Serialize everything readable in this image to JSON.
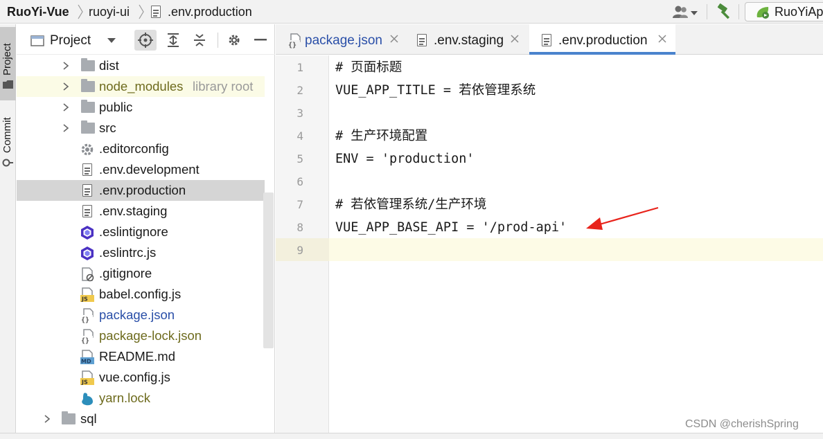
{
  "breadcrumb": {
    "project": "RuoYi-Vue",
    "folder": "ruoyi-ui",
    "file": ".env.production"
  },
  "toolbar": {
    "run_config_label": "RuoYiAp",
    "user_icon": "user-icon",
    "build_icon": "hammer-icon",
    "accent_green": "#4b8b3b"
  },
  "tool_window_tabs": {
    "project": "Project",
    "commit": "Commit"
  },
  "project_panel": {
    "title": "Project",
    "items": [
      {
        "label": "dist",
        "type": "folder",
        "expandable": true
      },
      {
        "label": "node_modules",
        "note": "library root",
        "type": "folder",
        "expandable": true
      },
      {
        "label": "public",
        "type": "folder",
        "expandable": true
      },
      {
        "label": "src",
        "type": "folder",
        "expandable": true
      },
      {
        "label": ".editorconfig",
        "type": "gear-file"
      },
      {
        "label": ".env.development",
        "type": "text-file"
      },
      {
        "label": ".env.production",
        "type": "text-file",
        "selected": true
      },
      {
        "label": ".env.staging",
        "type": "text-file"
      },
      {
        "label": ".eslintignore",
        "type": "eslint-file"
      },
      {
        "label": ".eslintrc.js",
        "type": "eslint-file"
      },
      {
        "label": ".gitignore",
        "type": "ignore-file"
      },
      {
        "label": "babel.config.js",
        "type": "js-file"
      },
      {
        "label": "package.json",
        "type": "json-file",
        "color": "blue"
      },
      {
        "label": "package-lock.json",
        "type": "json-file",
        "color": "olive"
      },
      {
        "label": "README.md",
        "type": "md-file"
      },
      {
        "label": "vue.config.js",
        "type": "js-file"
      },
      {
        "label": "yarn.lock",
        "type": "yarn-file",
        "color": "olive"
      },
      {
        "label": "sql",
        "type": "folder",
        "expandable": true,
        "level": 0
      }
    ]
  },
  "editor_tabs": [
    {
      "label": "package.json",
      "icon": "json-file-icon",
      "color": "blue"
    },
    {
      "label": ".env.staging",
      "icon": "text-file-icon"
    },
    {
      "label": ".env.production",
      "icon": "text-file-icon",
      "active": true
    }
  ],
  "editor": {
    "lines": [
      {
        "n": "1",
        "text": "# 页面标题"
      },
      {
        "n": "2",
        "text": "VUE_APP_TITLE = 若依管理系统"
      },
      {
        "n": "3",
        "text": ""
      },
      {
        "n": "4",
        "text": "# 生产环境配置"
      },
      {
        "n": "5",
        "text": "ENV = 'production'"
      },
      {
        "n": "6",
        "text": ""
      },
      {
        "n": "7",
        "text": "# 若依管理系统/生产环境"
      },
      {
        "n": "8",
        "text": "VUE_APP_BASE_API = '/prod-api'"
      },
      {
        "n": "9",
        "text": ""
      }
    ],
    "annotation_color": "#e8231b"
  },
  "watermark": "CSDN @cherishSpring"
}
